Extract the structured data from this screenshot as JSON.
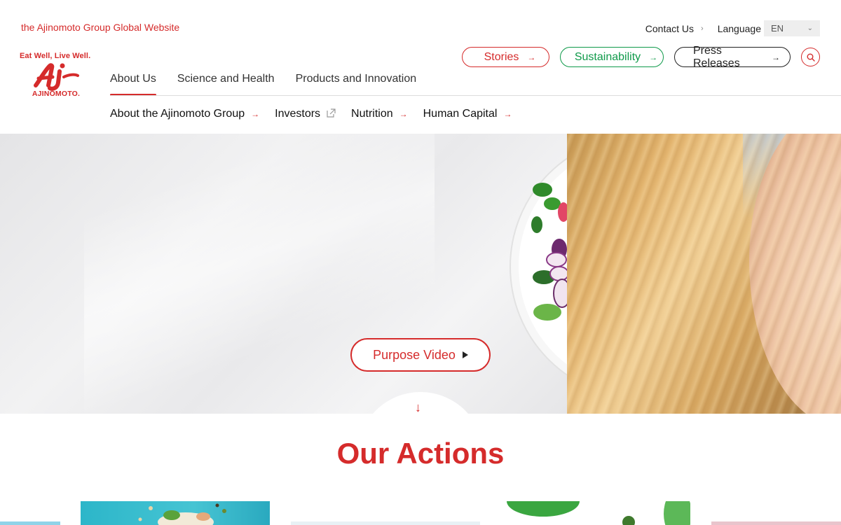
{
  "header": {
    "global_site_link": "the Ajinomoto Group Global Website",
    "contact_label": "Contact Us",
    "language_label": "Language",
    "language_value": "EN",
    "logo_tagline": "Eat Well, Live Well.",
    "logo_brand": "AJINOMOTO."
  },
  "pills": {
    "stories": "Stories",
    "sustainability": "Sustainability",
    "press": "Press Releases"
  },
  "main_nav": [
    {
      "label": "About Us",
      "active": true
    },
    {
      "label": "Science and Health",
      "active": false
    },
    {
      "label": "Products and Innovation",
      "active": false
    }
  ],
  "sub_nav": [
    {
      "label": "About the Ajinomoto Group",
      "icon": "arrow-right-icon"
    },
    {
      "label": "Investors",
      "icon": "external-link-icon"
    },
    {
      "label": "Nutrition",
      "icon": "arrow-right-icon"
    },
    {
      "label": "Human Capital",
      "icon": "arrow-right-icon"
    }
  ],
  "hero": {
    "video_button": "Purpose Video"
  },
  "section": {
    "title": "Our Actions"
  },
  "colors": {
    "brand_red": "#d52b2b",
    "sustainability_green": "#0f9a4a"
  }
}
